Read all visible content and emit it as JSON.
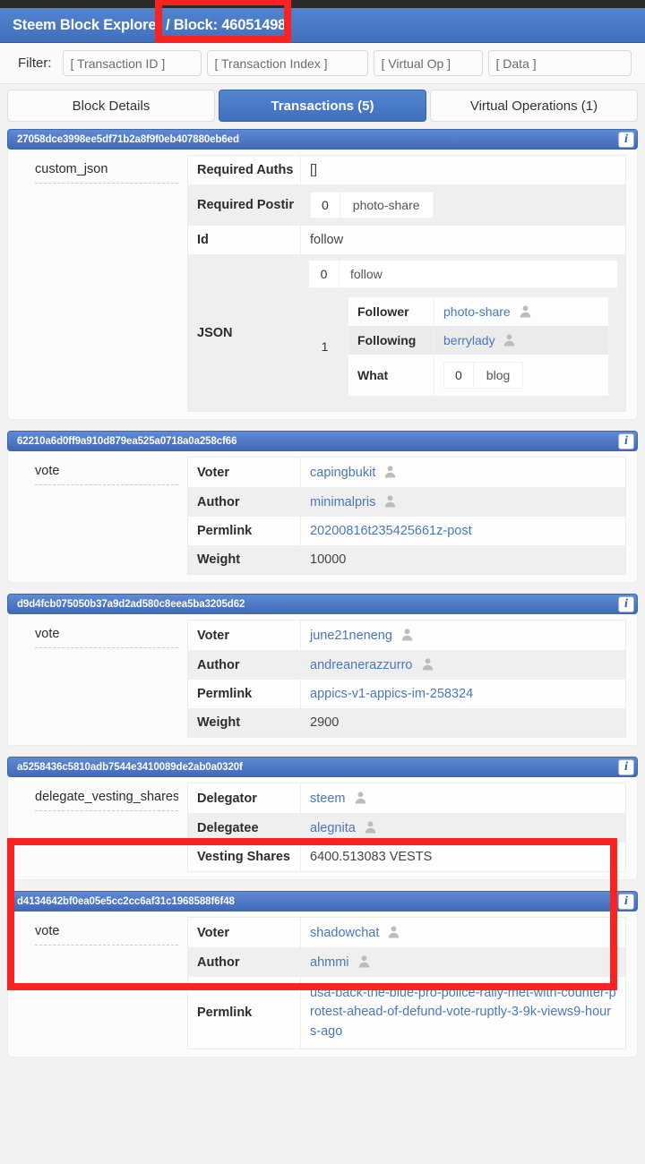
{
  "app": {
    "brand": "Steem Block Explorer / Block: 46051498",
    "dark_strip_color": "#2b2b2b",
    "navbar_color": "#4a77c4",
    "accent_color": "#4a79c6",
    "link_color": "#4a77b8",
    "annotation_color": "#fb2222"
  },
  "filter": {
    "label": "Filter:",
    "fields": [
      {
        "name": "transaction-id",
        "placeholder": "[ Transaction ID ]",
        "value": ""
      },
      {
        "name": "transaction-index",
        "placeholder": "[ Transaction Index ]",
        "value": ""
      },
      {
        "name": "virtual-op",
        "placeholder": "[ Virtual Op ]",
        "value": ""
      },
      {
        "name": "data",
        "placeholder": "[ Data ]",
        "value": ""
      }
    ]
  },
  "tabs": [
    {
      "label": "Block Details",
      "active": false
    },
    {
      "label": "Transactions (5)",
      "active": true
    },
    {
      "label": "Virtual Operations (1)",
      "active": false
    }
  ],
  "info_icon_glyph": "i",
  "transactions": [
    {
      "id": "27058dce3998ee5df71b2a8f9f0eb407880eb6ed",
      "op": "custom_json",
      "rows": {
        "required_auths_label": "Required Auths",
        "required_auths_value": "[]",
        "required_posting_label": "Required Postir",
        "required_posting_index": "0",
        "required_posting_value": "photo-share",
        "id_label": "Id",
        "id_value": "follow",
        "json_label": "JSON",
        "json_0_index": "0",
        "json_0_value": "follow",
        "json_1_index": "1",
        "follower_label": "Follower",
        "follower_value": "photo-share",
        "following_label": "Following",
        "following_value": "berrylady",
        "what_label": "What",
        "what_index": "0",
        "what_value": "blog"
      }
    },
    {
      "id": "62210a6d0ff9a910d879ea525a0718a0a258cf66",
      "op": "vote",
      "fields": [
        {
          "label": "Voter",
          "value": "capingbukit",
          "link": true,
          "avatar": true
        },
        {
          "label": "Author",
          "value": "minimalpris",
          "link": true,
          "avatar": true
        },
        {
          "label": "Permlink",
          "value": "20200816t235425661z-post",
          "link": true,
          "avatar": false
        },
        {
          "label": "Weight",
          "value": "10000",
          "link": false,
          "avatar": false
        }
      ]
    },
    {
      "id": "d9d4fcb075050b37a9d2ad580c8eea5ba3205d62",
      "op": "vote",
      "fields": [
        {
          "label": "Voter",
          "value": "june21neneng",
          "link": true,
          "avatar": true
        },
        {
          "label": "Author",
          "value": "andreanerazzurro",
          "link": true,
          "avatar": true
        },
        {
          "label": "Permlink",
          "value": "appics-v1-appics-im-258324",
          "link": true,
          "avatar": false
        },
        {
          "label": "Weight",
          "value": "2900",
          "link": false,
          "avatar": false
        }
      ]
    },
    {
      "id": "a5258436c5810adb7544e3410089de2ab0a0320f",
      "op": "delegate_vesting_shares",
      "highlighted": true,
      "fields": [
        {
          "label": "Delegator",
          "value": "steem",
          "link": true,
          "avatar": true
        },
        {
          "label": "Delegatee",
          "value": "alegnita",
          "link": true,
          "avatar": true
        },
        {
          "label": "Vesting Shares",
          "value": "6400.513083 VESTS",
          "link": false,
          "avatar": false
        }
      ]
    },
    {
      "id": "d4134642bf0ea05e5cc2cc6af31c1968588f6f48",
      "op": "vote",
      "fields": [
        {
          "label": "Voter",
          "value": "shadowchat",
          "link": true,
          "avatar": true
        },
        {
          "label": "Author",
          "value": "ahmmi",
          "link": true,
          "avatar": true
        },
        {
          "label": "Permlink",
          "value": "usa-back-the-blue-pro-police-rally-met-with-counter-protest-ahead-of-defund-vote-ruptly-3-9k-views9-hours-ago",
          "link": true,
          "avatar": false
        }
      ]
    }
  ],
  "icons": {
    "info": "info-icon",
    "avatar": "user-avatar-icon"
  }
}
